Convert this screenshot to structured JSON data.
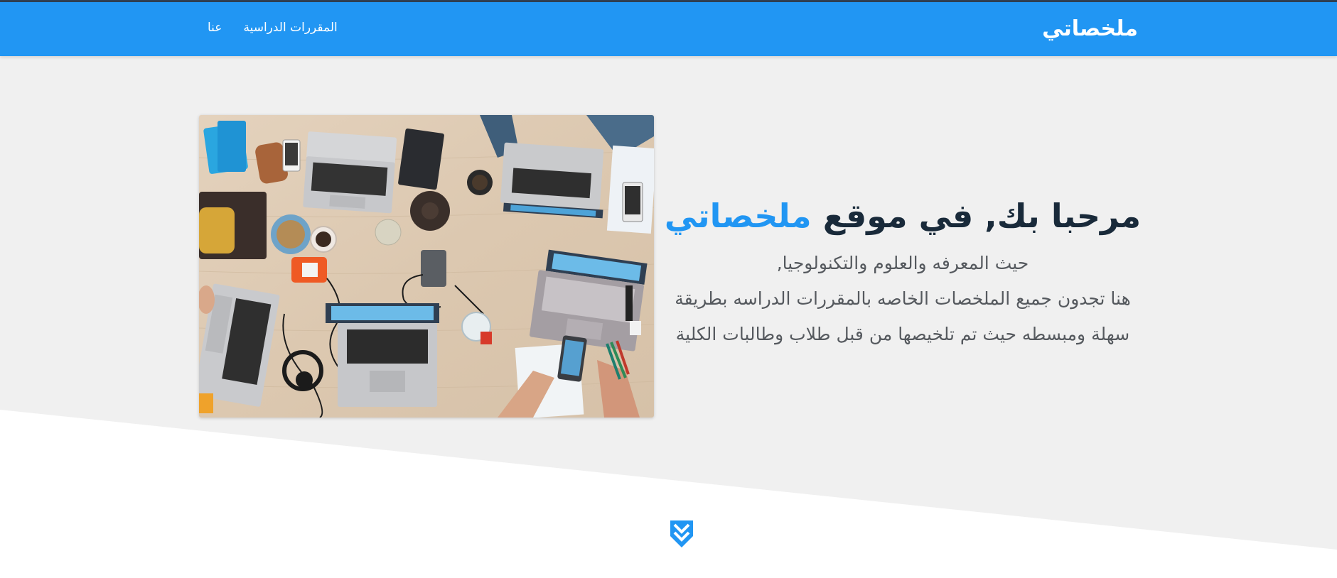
{
  "navbar": {
    "brand": "ملخصاتي",
    "links": [
      {
        "label": "المقررات الدراسية"
      },
      {
        "label": "عنا"
      }
    ]
  },
  "hero": {
    "title_part1": "مرحبا بك, في موقع",
    "title_accent": "ملخصاتي",
    "description_lines": [
      "حيث المعرفه والعلوم والتكنولوجيا,",
      "هنا تجدون جميع الملخصات الخاصه بالمقررات الدراسه بطريقة",
      "سهلة ومبسطه حيث تم تلخيصها من قبل طلاب وطالبات الكلية"
    ]
  },
  "icons": {
    "scroll_down": "double-chevron-down-icon"
  },
  "colors": {
    "primary": "#2196f3",
    "heading": "#192a3a",
    "text": "#55595e",
    "hero_background": "#f0f0f0",
    "page_background": "#ffffff"
  }
}
